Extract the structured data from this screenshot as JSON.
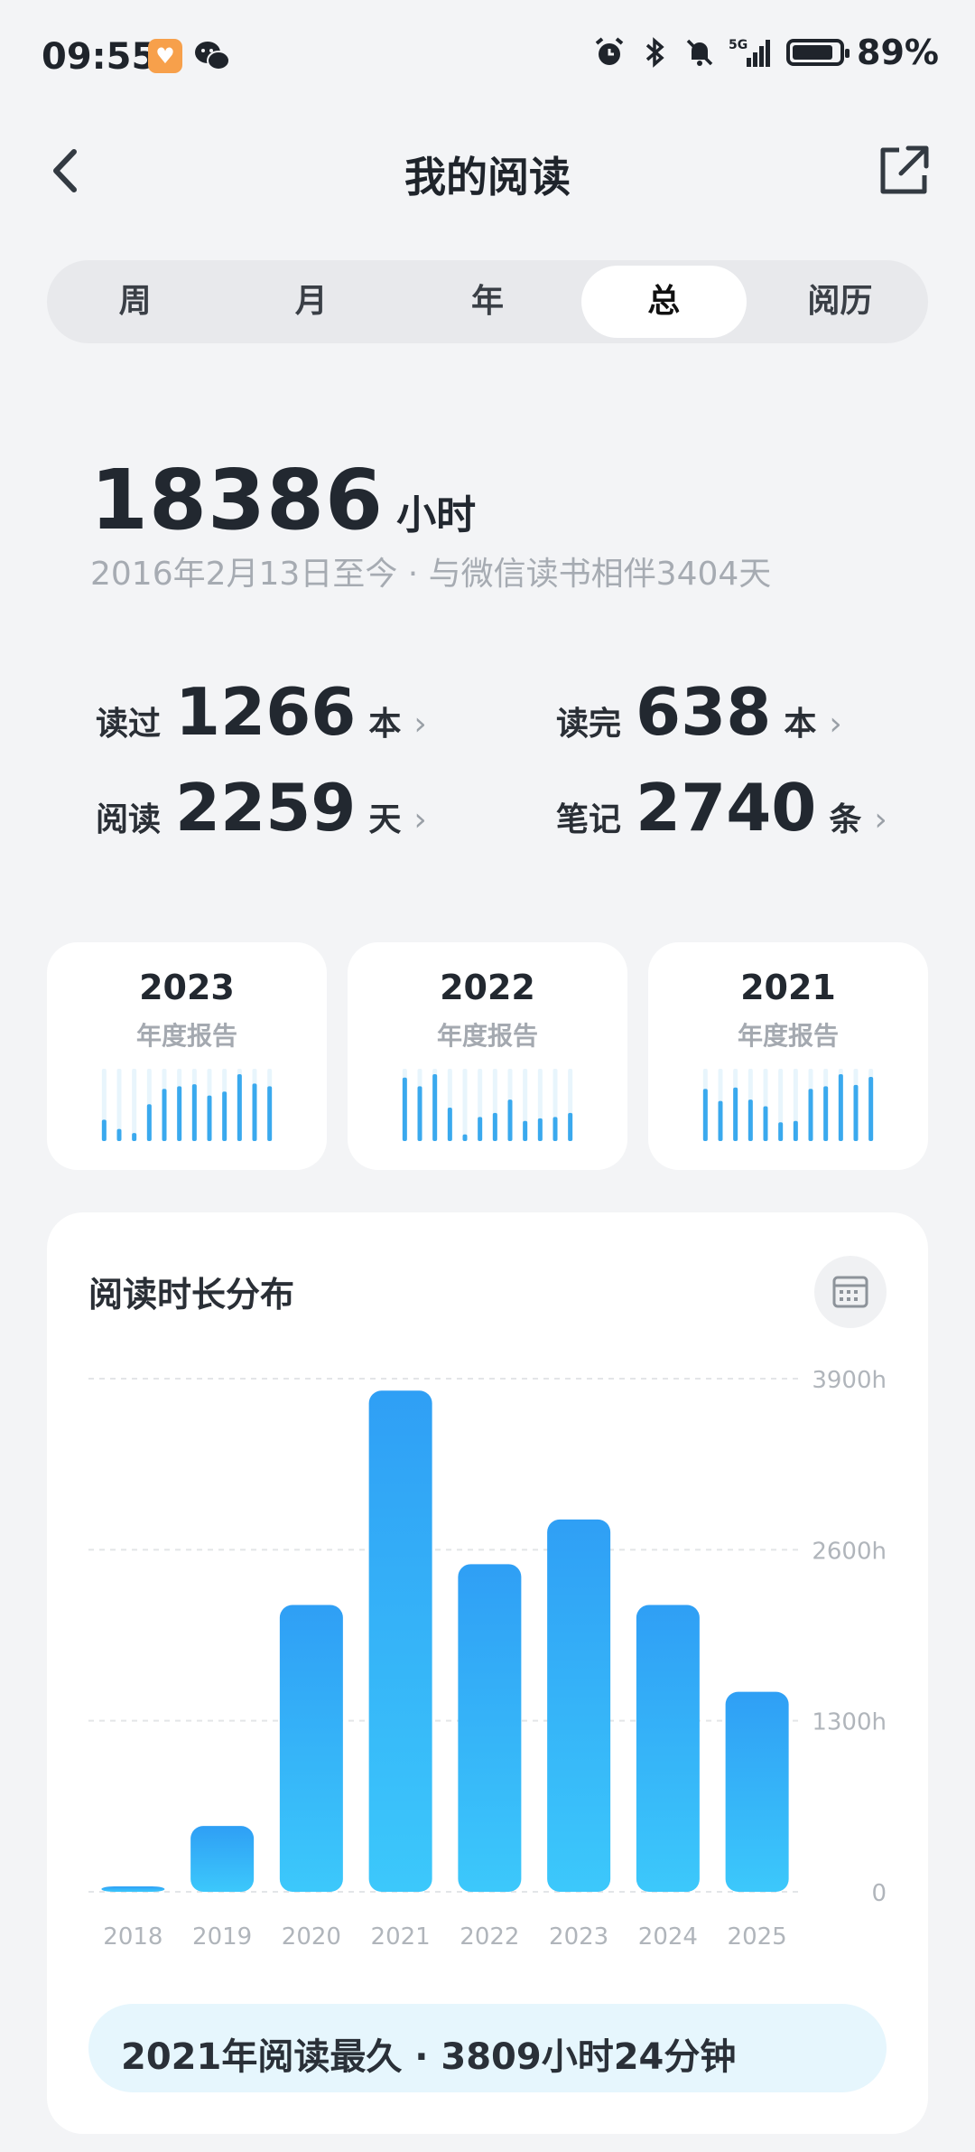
{
  "status_bar": {
    "time": "09:55",
    "battery_text": "89%",
    "network_label": "5G",
    "icons": [
      "app-icon-orange",
      "wechat-icon",
      "alarm-icon",
      "bluetooth-icon",
      "mute-icon",
      "signal-icon",
      "battery-icon"
    ]
  },
  "header": {
    "title": "我的阅读",
    "back_icon": "chevron-left-icon",
    "share_icon": "share-external-icon"
  },
  "tabs": [
    {
      "label": "周",
      "active": false
    },
    {
      "label": "月",
      "active": false
    },
    {
      "label": "年",
      "active": false
    },
    {
      "label": "总",
      "active": true
    },
    {
      "label": "阅历",
      "active": false
    }
  ],
  "total": {
    "hours": "18386",
    "unit": "小时",
    "since": "2016年2月13日至今 · 与微信读书相伴3404天"
  },
  "stats": [
    {
      "label": "读过",
      "value": "1266",
      "unit": "本"
    },
    {
      "label": "读完",
      "value": "638",
      "unit": "本"
    },
    {
      "label": "阅读",
      "value": "2259",
      "unit": "天"
    },
    {
      "label": "笔记",
      "value": "2740",
      "unit": "条"
    }
  ],
  "chevron": "›",
  "year_reports": [
    {
      "year": "2023",
      "label": "年度报告",
      "bars": [
        0.32,
        0.18,
        0.12,
        0.55,
        0.78,
        0.82,
        0.85,
        0.68,
        0.74,
        1.0,
        0.86,
        0.82
      ]
    },
    {
      "year": "2022",
      "label": "年度报告",
      "bars": [
        0.95,
        0.82,
        1.0,
        0.5,
        0.1,
        0.36,
        0.42,
        0.62,
        0.3,
        0.34,
        0.36,
        0.42
      ]
    },
    {
      "year": "2021",
      "label": "年度报告",
      "bars": [
        0.78,
        0.6,
        0.8,
        0.62,
        0.52,
        0.28,
        0.3,
        0.78,
        0.82,
        1.0,
        0.84,
        0.96
      ]
    }
  ],
  "distribution": {
    "title": "阅读时长分布",
    "calendar_icon": "calendar-icon",
    "summary": "2021年阅读最久 · 3809小时24分钟"
  },
  "chart_data": {
    "type": "bar",
    "categories": [
      "2018",
      "2019",
      "2020",
      "2021",
      "2022",
      "2023",
      "2024",
      "2025"
    ],
    "values": [
      30,
      500,
      2180,
      3809,
      2490,
      2830,
      2180,
      1520
    ],
    "ylim": [
      0,
      3900
    ],
    "yticks": [
      0,
      1300,
      2600,
      3900
    ],
    "ytick_labels": [
      "0",
      "1300h",
      "2600h",
      "3900h"
    ],
    "grid": true,
    "colors": {
      "bar_top": "#2f9ff5",
      "bar_bottom": "#3cc8fb",
      "grid": "#e3e5e8",
      "tick": "#b0b5bb"
    }
  }
}
